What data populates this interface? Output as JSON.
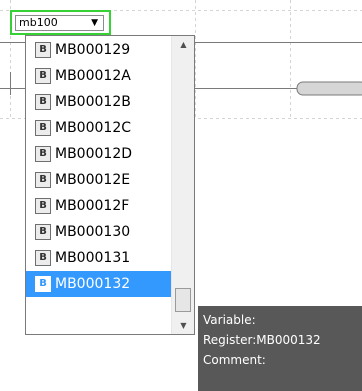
{
  "combo": {
    "value": "mb100",
    "arrow_icon": "chevron-down-icon"
  },
  "dropdown": {
    "badge_letter": "B",
    "items": [
      {
        "label": "MB000129"
      },
      {
        "label": "MB00012A"
      },
      {
        "label": "MB00012B"
      },
      {
        "label": "MB00012C"
      },
      {
        "label": "MB00012D"
      },
      {
        "label": "MB00012E"
      },
      {
        "label": "MB00012F"
      },
      {
        "label": "MB000130"
      },
      {
        "label": "MB000131"
      },
      {
        "label": "MB000132",
        "selected": true
      }
    ],
    "selected_index": 9,
    "scrollbar": {
      "up_icon": "arrow-up-icon",
      "down_icon": "arrow-down-icon",
      "up_glyph": "▲",
      "down_glyph": "▼",
      "position": 1.0
    }
  },
  "tooltip": {
    "lines": [
      "Variable:",
      "Register:MB000132",
      "Comment:"
    ]
  },
  "colors": {
    "combo_focus_border": "#35d135",
    "selection": "#3399ff",
    "tooltip_background": "#585858",
    "grid_line": "#cfcfcf"
  }
}
